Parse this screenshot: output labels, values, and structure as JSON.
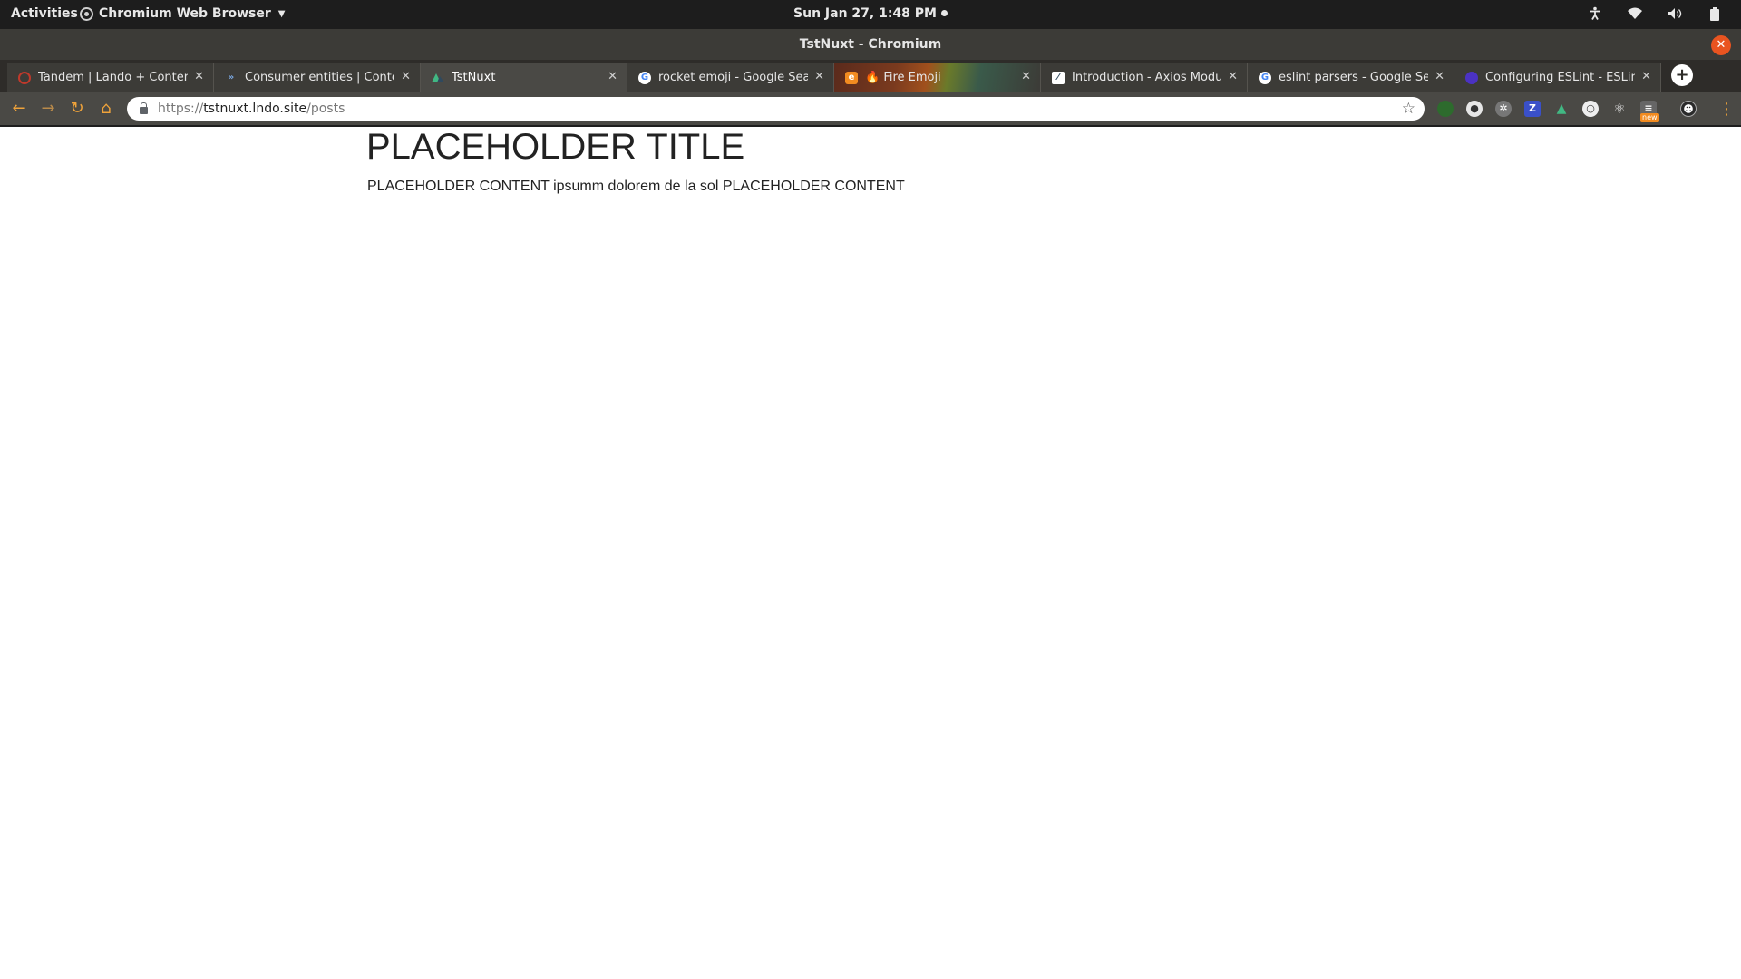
{
  "topbar": {
    "activities": "Activities",
    "app_name": "Chromium Web Browser",
    "clock": "Sun Jan 27,  1:48 PM"
  },
  "window": {
    "title": "TstNuxt - Chromium"
  },
  "tabs": [
    {
      "label": "Tandem | Lando + Contenta",
      "favicon": "tandem-icon",
      "color": "#c0392b"
    },
    {
      "label": "Consumer entities | Conten",
      "favicon": "contenta-icon",
      "color": "#3b6fb6"
    },
    {
      "label": "TstNuxt",
      "favicon": "nuxt-icon",
      "color": "#41b883"
    },
    {
      "label": "rocket emoji - Google Searc",
      "favicon": "google-icon",
      "color": "#ffffff"
    },
    {
      "label": "🔥 Fire Emoji",
      "favicon": "emojipedia-icon",
      "color": "#f28b20"
    },
    {
      "label": "Introduction - Axios Modul",
      "favicon": "axios-icon",
      "color": "#ffffff"
    },
    {
      "label": "eslint parsers - Google Sear",
      "favicon": "google-icon",
      "color": "#ffffff"
    },
    {
      "label": "Configuring ESLint - ESLint",
      "favicon": "eslint-icon",
      "color": "#4b32c3"
    }
  ],
  "address_bar": {
    "scheme": "https://",
    "host": "tstnuxt.lndo.site",
    "path": "/posts"
  },
  "extensions": {
    "badge": "new"
  },
  "page": {
    "title": "PLACEHOLDER TITLE",
    "content": "PLACEHOLDER CONTENT ipsumm dolorem de la sol PLACEHOLDER CONTENT"
  },
  "colors": {
    "accent": "#e95420",
    "nav_icon": "#f0a33a"
  }
}
